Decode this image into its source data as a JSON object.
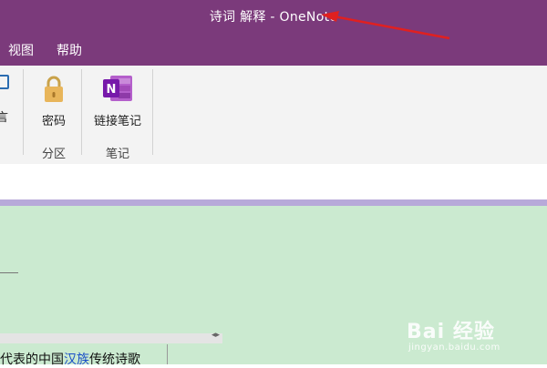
{
  "window": {
    "title": "诗词 解释  -  OneNote"
  },
  "menu": {
    "view_label": "视图",
    "help_label": "帮助"
  },
  "ribbon": {
    "password_label": "密码",
    "link_note_label": "链接笔记",
    "group_section": "分区",
    "group_notes": "笔记",
    "partial_left_label": "言"
  },
  "page": {
    "content_prefix": "代表的中国",
    "content_link": "汉族",
    "content_suffix": "传统诗歌"
  },
  "watermark": {
    "main": "Bai 经验",
    "sub": "jingyan.baidu.com"
  },
  "colors": {
    "title_bar": "#7b3a7b",
    "ribbon_bg": "#f3f3f3",
    "page_bg": "#cbead0",
    "accent_line": "#b7a9d9",
    "annotation_arrow": "#e02020",
    "link": "#1a4fc7"
  },
  "icons": {
    "password": "padlock-icon",
    "link_note": "onenote-icon",
    "arrow": "red-arrow-annotation"
  }
}
